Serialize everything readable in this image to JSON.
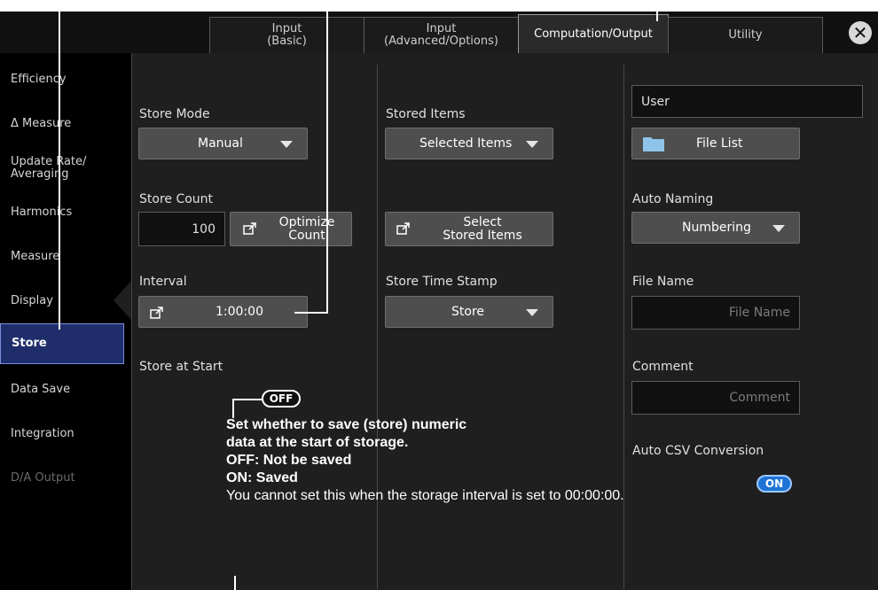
{
  "tabs": [
    {
      "label": "Input\n(Basic)"
    },
    {
      "label": "Input\n(Advanced/Options)"
    },
    {
      "label": "Computation/Output"
    },
    {
      "label": "Utility"
    }
  ],
  "close_icon": "close-icon",
  "sidebar": {
    "items": [
      {
        "label": "Efficiency"
      },
      {
        "label": "Δ Measure"
      },
      {
        "label": "Update Rate/\nAveraging"
      },
      {
        "label": "Harmonics"
      },
      {
        "label": "Measure"
      },
      {
        "label": "Display"
      },
      {
        "label": "Store"
      },
      {
        "label": "Data Save"
      },
      {
        "label": "Integration"
      },
      {
        "label": "D/A Output"
      }
    ],
    "active": "Store"
  },
  "store": {
    "mode_label": "Store Mode",
    "mode_value": "Manual",
    "count_label": "Store Count",
    "count_value": "100",
    "optimize_label": "Optimize\nCount",
    "interval_label": "Interval",
    "interval_value": "1:00:00",
    "at_start_label": "Store at Start",
    "at_start_toggle": "OFF"
  },
  "items": {
    "label": "Stored Items",
    "value": "Selected Items",
    "select_label": "Select\nStored Items",
    "timestamp_label": "Store Time Stamp",
    "timestamp_value": "Store"
  },
  "file": {
    "user_value": "User",
    "file_list_label": "File List",
    "auto_naming_label": "Auto Naming",
    "auto_naming_value": "Numbering",
    "file_name_label": "File Name",
    "file_name_placeholder": "File Name",
    "comment_label": "Comment",
    "comment_placeholder": "Comment",
    "csv_label": "Auto CSV Conversion",
    "csv_toggle": "ON"
  },
  "callout": {
    "line1": "Set whether to save (store) numeric",
    "line2": "data at the start of storage.",
    "line3": "OFF: Not be saved",
    "line4": "ON: Saved",
    "line5": "You cannot set this when the storage interval is set to 00:00:00."
  }
}
